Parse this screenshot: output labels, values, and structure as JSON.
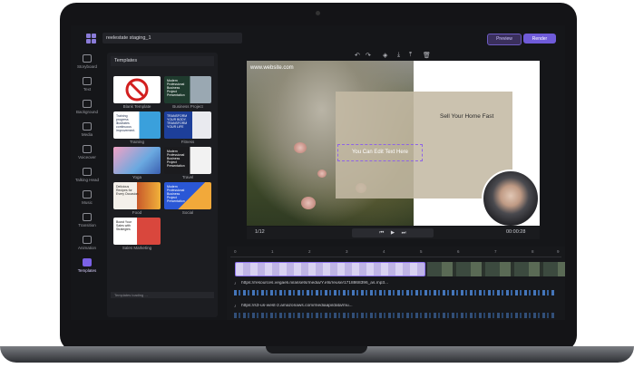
{
  "app": {
    "project_name": "reelestate staging_1",
    "preview_label": "Preview",
    "render_label": "Render"
  },
  "sidebar": {
    "items": [
      {
        "label": "Storyboard",
        "icon": "storyboard-icon"
      },
      {
        "label": "Text",
        "icon": "text-icon"
      },
      {
        "label": "Background",
        "icon": "background-icon"
      },
      {
        "label": "Media",
        "icon": "media-icon"
      },
      {
        "label": "Voiceover",
        "icon": "voiceover-icon"
      },
      {
        "label": "Talking Head",
        "icon": "talking-head-icon"
      },
      {
        "label": "Music",
        "icon": "music-icon"
      },
      {
        "label": "Transition",
        "icon": "transition-icon"
      },
      {
        "label": "Animation",
        "icon": "animation-icon"
      },
      {
        "label": "Templates",
        "icon": "templates-icon",
        "active": true
      }
    ]
  },
  "templates_panel": {
    "title": "Templates",
    "items": [
      {
        "label": "Blank Template"
      },
      {
        "label": "Business Project",
        "text": "Modern Professional Business Project Presentation"
      },
      {
        "label": "Training",
        "text": "Training progress illustrates continuous improvement."
      },
      {
        "label": "Fitness",
        "text": "TRANSFORM YOUR BODY, TRANSFORM YOUR LIFE"
      },
      {
        "label": "Yoga"
      },
      {
        "label": "Travel",
        "text": "Modern Professional Business Project Presentation"
      },
      {
        "label": "Food",
        "text": "Delicious Recipes for Every Occasion"
      },
      {
        "label": "Social",
        "text": "Modern Professional Business Project Presentation"
      },
      {
        "label": "Sales Marketing",
        "text": "Boost Your Sales with Strategies"
      }
    ],
    "scroll_hint": "Templates loading ..."
  },
  "canvas": {
    "site_url": "www.website.com",
    "headline": "Sell Your Home Fast",
    "editable_text": "You Can Edit Text Here"
  },
  "player": {
    "page_count": "1/12",
    "timecode": "00:00:28"
  },
  "timeline": {
    "ticks": [
      "0",
      "1",
      "2",
      "3",
      "4",
      "5",
      "6",
      "7",
      "8",
      "9"
    ],
    "audio_tracks": [
      {
        "url": "https://resources.vegaeli.ni/assets/media/Y.ets/reuse/1718868396_as.mp3..."
      },
      {
        "url": "https://s3-us-west-2.amazonaws.com/mediaapi/data/mu..."
      }
    ]
  },
  "colors": {
    "accent": "#7b61e6",
    "background": "#151619",
    "canvas_overlay": "#c4b9a4"
  }
}
